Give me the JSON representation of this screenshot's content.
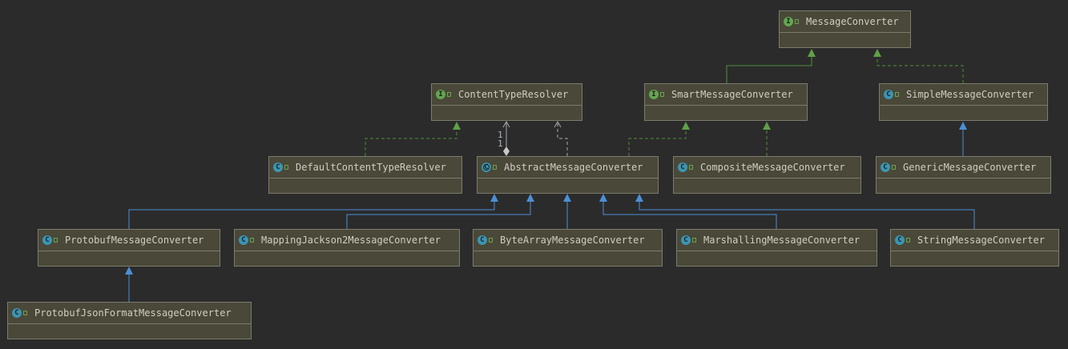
{
  "nodes": [
    {
      "id": "MessageConverter",
      "label": "MessageConverter",
      "kind": "interface"
    },
    {
      "id": "ContentTypeResolver",
      "label": "ContentTypeResolver",
      "kind": "interface"
    },
    {
      "id": "SmartMessageConverter",
      "label": "SmartMessageConverter",
      "kind": "interface"
    },
    {
      "id": "SimpleMessageConverter",
      "label": "SimpleMessageConverter",
      "kind": "class"
    },
    {
      "id": "DefaultContentTypeResolver",
      "label": "DefaultContentTypeResolver",
      "kind": "class"
    },
    {
      "id": "AbstractMessageConverter",
      "label": "AbstractMessageConverter",
      "kind": "abstract-class"
    },
    {
      "id": "CompositeMessageConverter",
      "label": "CompositeMessageConverter",
      "kind": "class"
    },
    {
      "id": "GenericMessageConverter",
      "label": "GenericMessageConverter",
      "kind": "class"
    },
    {
      "id": "ProtobufMessageConverter",
      "label": "ProtobufMessageConverter",
      "kind": "class"
    },
    {
      "id": "MappingJackson2MessageConverter",
      "label": "MappingJackson2MessageConverter",
      "kind": "class"
    },
    {
      "id": "ByteArrayMessageConverter",
      "label": "ByteArrayMessageConverter",
      "kind": "class"
    },
    {
      "id": "MarshallingMessageConverter",
      "label": "MarshallingMessageConverter",
      "kind": "class"
    },
    {
      "id": "StringMessageConverter",
      "label": "StringMessageConverter",
      "kind": "class"
    },
    {
      "id": "ProtobufJsonFormatMessageConverter",
      "label": "ProtobufJsonFormatMessageConverter",
      "kind": "class"
    }
  ],
  "edges": [
    {
      "from": "SmartMessageConverter",
      "to": "MessageConverter",
      "type": "interface-extends"
    },
    {
      "from": "SimpleMessageConverter",
      "to": "MessageConverter",
      "type": "implements"
    },
    {
      "from": "DefaultContentTypeResolver",
      "to": "ContentTypeResolver",
      "type": "implements"
    },
    {
      "from": "AbstractMessageConverter",
      "to": "ContentTypeResolver",
      "type": "aggregation",
      "multiplicity_source": "1",
      "multiplicity_target": "1"
    },
    {
      "from": "AbstractMessageConverter",
      "to": "ContentTypeResolver",
      "type": "dependency"
    },
    {
      "from": "AbstractMessageConverter",
      "to": "SmartMessageConverter",
      "type": "implements"
    },
    {
      "from": "CompositeMessageConverter",
      "to": "SmartMessageConverter",
      "type": "implements"
    },
    {
      "from": "GenericMessageConverter",
      "to": "SimpleMessageConverter",
      "type": "extends"
    },
    {
      "from": "ProtobufMessageConverter",
      "to": "AbstractMessageConverter",
      "type": "extends"
    },
    {
      "from": "MappingJackson2MessageConverter",
      "to": "AbstractMessageConverter",
      "type": "extends"
    },
    {
      "from": "ByteArrayMessageConverter",
      "to": "AbstractMessageConverter",
      "type": "extends"
    },
    {
      "from": "MarshallingMessageConverter",
      "to": "AbstractMessageConverter",
      "type": "extends"
    },
    {
      "from": "StringMessageConverter",
      "to": "AbstractMessageConverter",
      "type": "extends"
    },
    {
      "from": "ProtobufJsonFormatMessageConverter",
      "to": "ProtobufMessageConverter",
      "type": "extends"
    }
  ],
  "colors": {
    "background": "#2b2b2b",
    "node_fill": "#4a4838",
    "node_border": "#7b7b6e",
    "extends_line": "#4c8fd6",
    "implements_line": "#4f8f3c",
    "implements_arrow": "#5fa148",
    "aggregation_line": "#a9a9a9",
    "interface_badge": "#62a550",
    "class_badge": "#3b95b3"
  }
}
